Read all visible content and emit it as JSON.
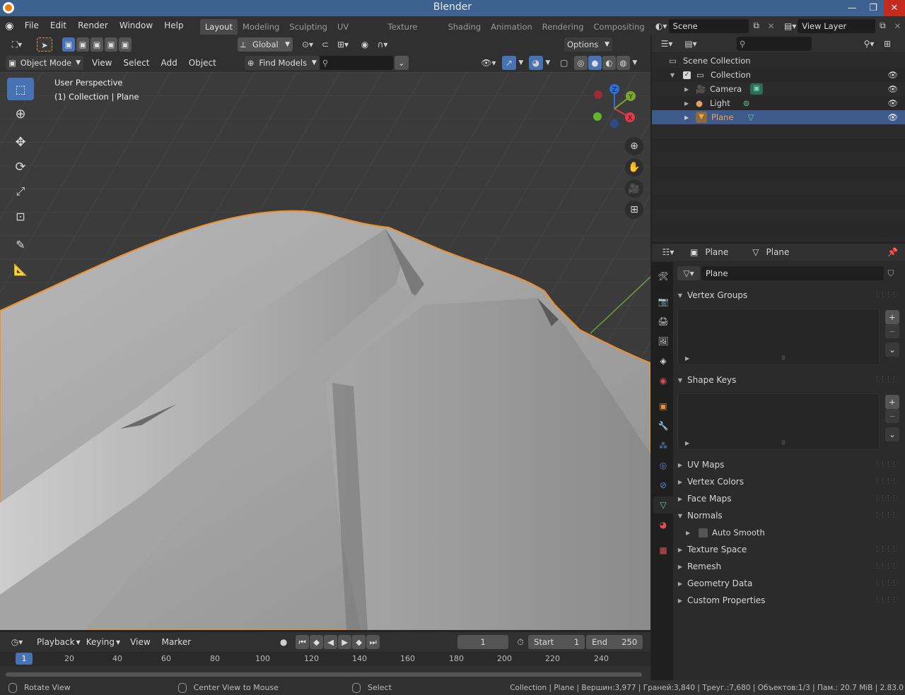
{
  "window": {
    "title": "Blender",
    "controls": [
      "—",
      "❐",
      "✕"
    ]
  },
  "menu": [
    "File",
    "Edit",
    "Render",
    "Window",
    "Help"
  ],
  "workspaces": [
    "Layout",
    "Modeling",
    "Sculpting",
    "UV Editing",
    "Texture Paint",
    "Shading",
    "Animation",
    "Rendering",
    "Compositing"
  ],
  "active_workspace": "Layout",
  "scene": {
    "label": "Scene"
  },
  "view_layer": {
    "label": "View Layer"
  },
  "viewport_header": {
    "transform_orientation": "Global",
    "options_label": "Options",
    "mode": "Object Mode",
    "menus": [
      "View",
      "Select",
      "Add",
      "Object"
    ],
    "find_label": "Find Models",
    "search_placeholder": ""
  },
  "viewport": {
    "info_line1": "User Perspective",
    "info_line2": "(1) Collection | Plane",
    "gizmo": {
      "x": "X",
      "y": "Y",
      "z": "Z"
    }
  },
  "outliner": {
    "root": "Scene Collection",
    "collection": "Collection",
    "items": [
      {
        "name": "Camera",
        "icon": "camera-icon",
        "color": "#e0a060"
      },
      {
        "name": "Light",
        "icon": "light-icon",
        "color": "#e0a060"
      },
      {
        "name": "Plane",
        "icon": "mesh-icon",
        "color": "#e89a40",
        "selected": true
      }
    ]
  },
  "properties": {
    "breadcrumb_object": "Plane",
    "breadcrumb_data": "Plane",
    "data_name": "Plane",
    "panels": [
      {
        "label": "Vertex Groups",
        "open": true
      },
      {
        "label": "Shape Keys",
        "open": true
      },
      {
        "label": "UV Maps",
        "open": false
      },
      {
        "label": "Vertex Colors",
        "open": false
      },
      {
        "label": "Face Maps",
        "open": false
      },
      {
        "label": "Normals",
        "open": true
      },
      {
        "label": "Texture Space",
        "open": false
      },
      {
        "label": "Remesh",
        "open": false
      },
      {
        "label": "Geometry Data",
        "open": false
      },
      {
        "label": "Custom Properties",
        "open": false
      }
    ],
    "auto_smooth_label": "Auto Smooth"
  },
  "timeline": {
    "menus": [
      "Playback",
      "Keying",
      "View",
      "Marker"
    ],
    "current_frame": "1",
    "start_label": "Start",
    "start": "1",
    "end_label": "End",
    "end": "250",
    "ticks": [
      "1",
      "20",
      "40",
      "60",
      "80",
      "100",
      "120",
      "140",
      "160",
      "180",
      "200",
      "220",
      "240"
    ]
  },
  "status": {
    "left": [
      {
        "icon": "mouse-left-icon",
        "label": "Rotate View"
      },
      {
        "icon": "mouse-middle-icon",
        "label": "Center View to Mouse"
      },
      {
        "icon": "mouse-right-icon",
        "label": "Select"
      }
    ],
    "right": "Collection | Plane | Вершин:3,977 | Граней:3,840 | Треуг.:7,680 | Объектов:1/3 | Пам.: 20.7 MiB | 2.83.0"
  },
  "colors": {
    "accent": "#4772b3",
    "selection_outline": "#f0902a",
    "titlebar": "#3d6290"
  }
}
